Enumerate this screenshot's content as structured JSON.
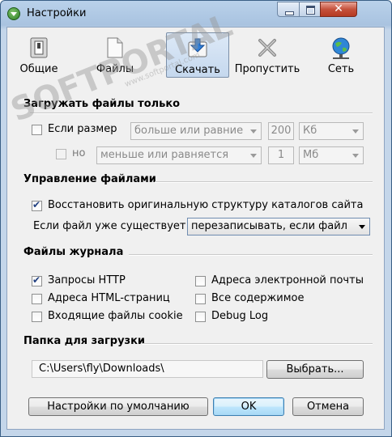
{
  "window": {
    "title": "Настройки"
  },
  "toolbar": {
    "items": [
      {
        "label": "Общие",
        "icon": "switch-icon"
      },
      {
        "label": "Файлы",
        "icon": "file-icon"
      },
      {
        "label": "Скачать",
        "icon": "download-icon"
      },
      {
        "label": "Пропустить",
        "icon": "skip-x-icon"
      },
      {
        "label": "Сеть",
        "icon": "globe-network-icon"
      }
    ],
    "active_index": 2
  },
  "download_only": {
    "heading": "Загружать файлы только",
    "size_checkbox": {
      "label": "Если размер",
      "checked": false
    },
    "size_condition": "больше или равние",
    "size_value": "200",
    "size_unit": "Кб",
    "and_checkbox": {
      "label": "но",
      "checked": false
    },
    "and_condition": "меньше или равняется",
    "and_value": "1",
    "and_unit": "Мб"
  },
  "file_management": {
    "heading": "Управление файлами",
    "restore_structure": {
      "label": "Восстановить оригинальную структуру каталогов сайта",
      "checked": true
    },
    "exists_label": "Если файл уже существует",
    "exists_option": "перезаписывать, если файл"
  },
  "log_files": {
    "heading": "Файлы журнала",
    "left": [
      {
        "label": "Запросы HTTP",
        "checked": true
      },
      {
        "label": "Адреса HTML-страниц",
        "checked": false
      },
      {
        "label": "Входящие файлы cookie",
        "checked": false
      }
    ],
    "right": [
      {
        "label": "Адреса электронной почты",
        "checked": false
      },
      {
        "label": "Все содержимое",
        "checked": false
      },
      {
        "label": "Debug Log",
        "checked": false
      }
    ]
  },
  "download_folder": {
    "heading": "Папка для загрузки",
    "path": "C:\\Users\\fly\\Downloads\\",
    "browse_label": "Выбрать..."
  },
  "buttons": {
    "defaults": "Настройки по умолчанию",
    "ok": "OK",
    "cancel": "Отмена"
  },
  "watermark": {
    "text": "SOFTPORTAL",
    "sub": "www.softportal.com"
  }
}
